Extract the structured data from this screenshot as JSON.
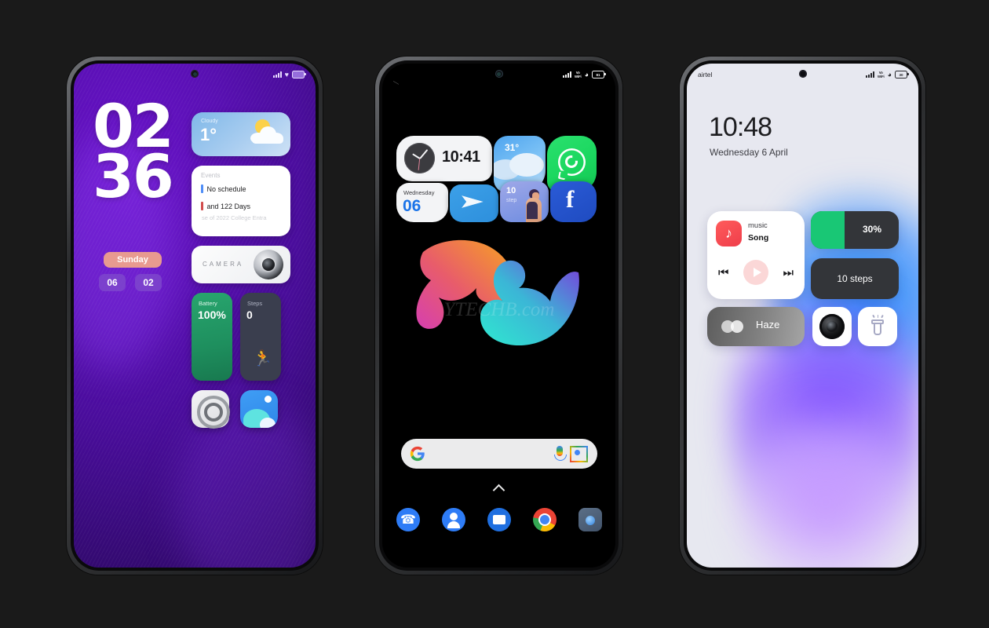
{
  "page": {
    "background": "#1a1a1a",
    "watermark": "YTECHB.com"
  },
  "phone1": {
    "statusbar": {
      "signal": "signal-bars",
      "heart": "heart-icon",
      "battery": "battery-icon"
    },
    "clock": {
      "hours": "02",
      "minutes": "36"
    },
    "date": {
      "weekday": "Sunday",
      "month": "06",
      "day": "02"
    },
    "weather": {
      "condition": "Cloudy",
      "temperature": "1°"
    },
    "events": {
      "title": "Events",
      "item1": "No schedule",
      "item2": "and 122 Days",
      "subtitle": "se of 2022 College Entra"
    },
    "camera": {
      "label": "CAMERA"
    },
    "battery": {
      "label": "Battery",
      "value": "100%"
    },
    "steps": {
      "label": "Steps",
      "value": "0"
    }
  },
  "phone2": {
    "statusbar": {
      "signal": "signal-bars",
      "network": "Vo\nWiFi",
      "wifi": "wifi-icon",
      "battery": "81"
    },
    "clock_widget": {
      "time": "10:41"
    },
    "weather_widget": {
      "temperature": "31°"
    },
    "whatsapp": {
      "label": "whatsapp-icon"
    },
    "day_widget": {
      "weekday": "Wednesday",
      "date": "06"
    },
    "telegram": {
      "label": "telegram-icon"
    },
    "steps_widget": {
      "count": "10",
      "unit": "step"
    },
    "facebook": {
      "label": "f"
    },
    "search": {
      "placeholder": "",
      "google": "google-logo",
      "mic": "mic-icon",
      "lens": "lens-icon"
    },
    "dock": [
      "phone-icon",
      "contacts-icon",
      "messages-icon",
      "chrome-icon",
      "camera-icon"
    ]
  },
  "phone3": {
    "statusbar": {
      "carrier": "airtel",
      "network": "Vo\nWiFi",
      "wifi": "wifi-icon",
      "battery": "30"
    },
    "lockscreen": {
      "time": "10:48",
      "date": "Wednesday 6 April"
    },
    "music": {
      "app": "music",
      "title": "Song",
      "prev": "⏮",
      "play": "play-icon",
      "next": "⏭"
    },
    "battery_widget": {
      "value": "30%",
      "fill_percent": 38
    },
    "steps_widget": {
      "label": "10 steps"
    },
    "haze": {
      "label": "Haze"
    },
    "camera": {
      "label": "camera-icon"
    },
    "flashlight": {
      "label": "flashlight-icon"
    }
  }
}
